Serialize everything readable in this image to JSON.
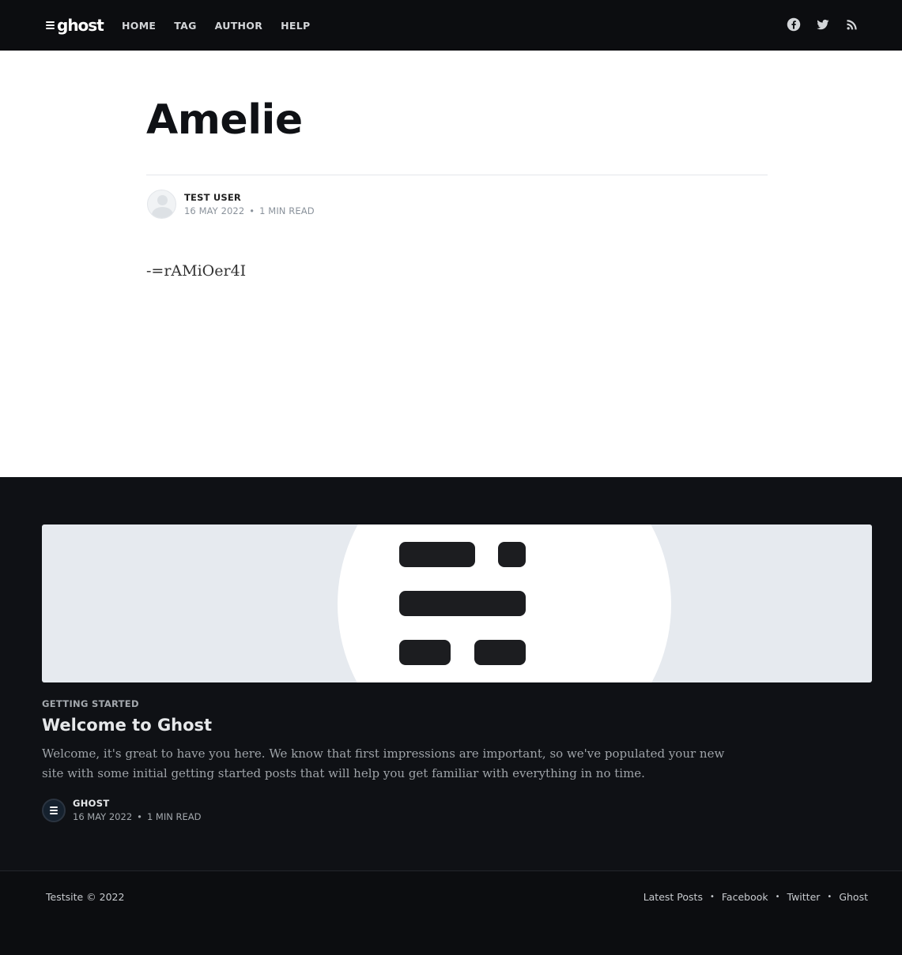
{
  "header": {
    "logo_text": "ghost",
    "nav": [
      {
        "label": "HOME"
      },
      {
        "label": "TAG"
      },
      {
        "label": "AUTHOR"
      },
      {
        "label": "HELP"
      }
    ],
    "social_icons": [
      "facebook-icon",
      "twitter-icon",
      "rss-icon"
    ]
  },
  "article": {
    "title": "Amelie",
    "author": "TEST USER",
    "date": "16 MAY 2022",
    "read_time": "1 MIN READ",
    "body": "-=rAMiOer4I"
  },
  "related": {
    "tag": "GETTING STARTED",
    "title": "Welcome to Ghost",
    "excerpt": "Welcome, it's great to have you here. We know that first impressions are important, so we've populated your new site with some initial getting started posts that will help you get familiar with everything in no time.",
    "author": "GHOST",
    "date": "16 MAY 2022",
    "read_time": "1 MIN READ"
  },
  "footer": {
    "copyright": "Testsite © 2022",
    "links": [
      {
        "label": "Latest Posts"
      },
      {
        "label": "Facebook"
      },
      {
        "label": "Twitter"
      },
      {
        "label": "Ghost"
      }
    ]
  },
  "colors": {
    "header_bg": "#0c0d10",
    "article_bg": "#ffffff",
    "dark_bg": "#0f1115",
    "feature_bg": "#e6eaef"
  }
}
